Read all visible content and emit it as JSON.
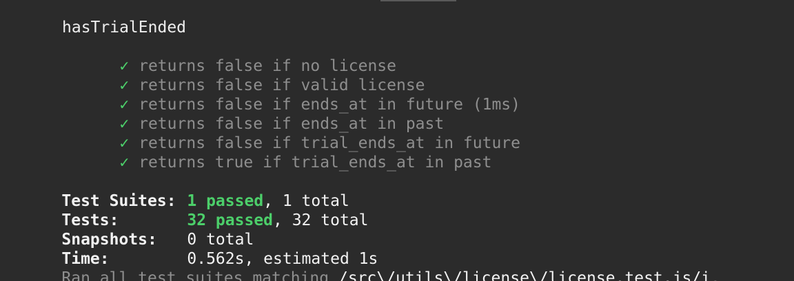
{
  "suite": {
    "name": "hasTrialEnded",
    "check_glyph": "✓",
    "tests": [
      {
        "title": "returns false if no license"
      },
      {
        "title": "returns false if valid license"
      },
      {
        "title": "returns false if ends_at in future (1ms)"
      },
      {
        "title": "returns false if ends_at in past"
      },
      {
        "title": "returns false if trial_ends_at in future"
      },
      {
        "title": "returns true if trial_ends_at in past"
      }
    ]
  },
  "summary": {
    "suites_label": "Test Suites:",
    "suites_passed": "1 passed",
    "suites_total": ", 1 total",
    "tests_label": "Tests:",
    "tests_passed": "32 passed",
    "tests_total": ", 32 total",
    "snapshots_label": "Snapshots:",
    "snapshots_value": "0 total",
    "time_label": "Time:",
    "time_value": "0.562s, estimated 1s",
    "ran_prefix": "Ran all test suites matching ",
    "ran_pattern": "/src\\/utils\\/license\\/license.test.js/i",
    "ran_suffix": "."
  },
  "colors": {
    "background": "#2b2b2b",
    "pass_green": "#4ccf6a",
    "dim_gray": "#8e8e8e",
    "text": "#f2f2f2"
  }
}
